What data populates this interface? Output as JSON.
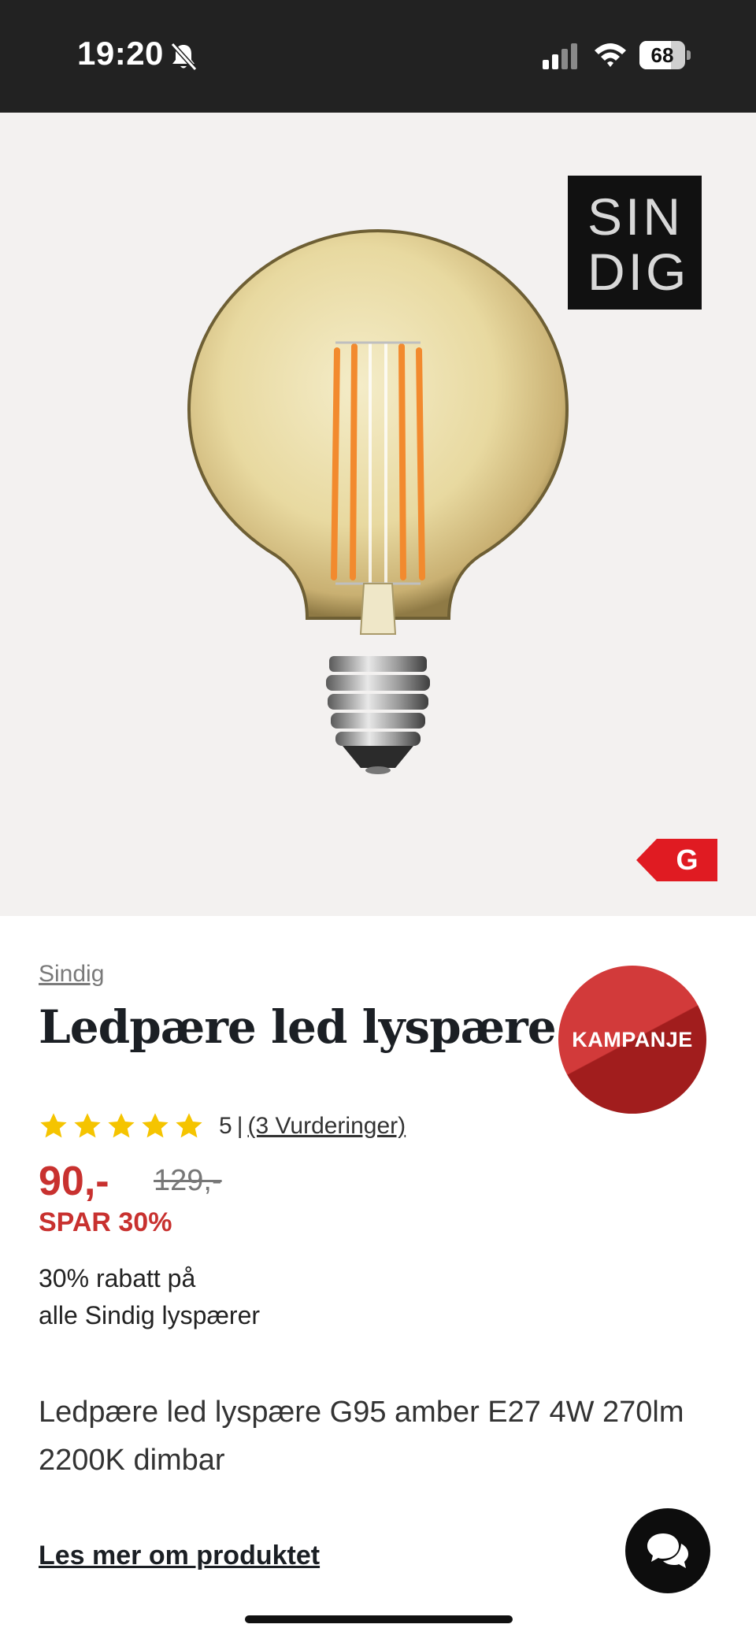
{
  "status_bar": {
    "time": "19:20",
    "battery": "68",
    "icons": [
      "bell-slash-icon",
      "signal-icon",
      "wifi-icon",
      "battery-icon"
    ]
  },
  "product": {
    "image_alt": "G95 amber filament LED bulb",
    "logo_text_top": "SIN",
    "logo_text_bottom": "DIG",
    "energy_class": "G",
    "brand": "Sindig",
    "title": "Ledpære led lyspære",
    "campaign_badge": "KAMPANJE",
    "rating": {
      "stars": 5,
      "value": "5",
      "separator": "|",
      "reviews_label": "(3 Vurderinger)"
    },
    "price": "90,-",
    "old_price": "129,-",
    "saving": "SPAR 30%",
    "promo_line1": "30% rabatt på",
    "promo_line2": "alle Sindig lyspærer",
    "description": "Ledpære led lyspære G95 amber E27 4W 270lm 2200K dimbar",
    "read_more": "Les mer om produktet"
  },
  "colors": {
    "accent_red": "#c8312f",
    "energy_red": "#e01b22",
    "star_yellow": "#f5c400",
    "status_bar_bg": "#222222"
  }
}
